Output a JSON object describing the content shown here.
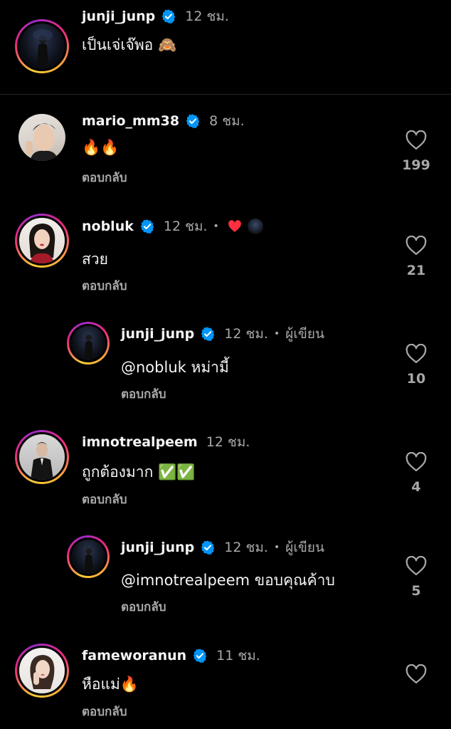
{
  "caption": {
    "username": "junji_junp",
    "time": "12 ชม.",
    "text": "เป็นเจ่เจ๊พอ 🙈"
  },
  "comments": [
    {
      "username": "mario_mm38",
      "time": "8 ชม.",
      "text": "🔥🔥",
      "reply_label": "ตอบกลับ",
      "likes": "199"
    },
    {
      "username": "nobluk",
      "time": "12 ชม.",
      "dot": "•",
      "text": "สวย",
      "reply_label": "ตอบกลับ",
      "likes": "21"
    },
    {
      "username": "junji_junp",
      "time": "12 ชม.",
      "dot": "•",
      "author_tag": "ผู้เขียน",
      "mention": "@nobluk",
      "text": "หม่ามี้",
      "reply_label": "ตอบกลับ",
      "likes": "10"
    },
    {
      "username": "imnotrealpeem",
      "time": "12 ชม.",
      "text": "ถูกต้องมาก ✅✅",
      "reply_label": "ตอบกลับ",
      "likes": "4"
    },
    {
      "username": "junji_junp",
      "time": "12 ชม.",
      "dot": "•",
      "author_tag": "ผู้เขียน",
      "mention": "@imnotrealpeem",
      "text": "ขอบคุณค้าบ",
      "reply_label": "ตอบกลับ",
      "likes": "5"
    },
    {
      "username": "fameworanun",
      "time": "11 ชม.",
      "text": "หือแม่🔥",
      "reply_label": "ตอบกลับ"
    }
  ],
  "colors": {
    "background": "#000000",
    "text_primary": "#f5f5f5",
    "text_secondary": "#a8a8a8",
    "verified_blue": "#0095f6",
    "liked_red": "#ff3040"
  },
  "icons": {
    "verified": "verified-badge-icon",
    "like": "heart-outline-icon",
    "creator_like": "heart-filled-icon"
  }
}
